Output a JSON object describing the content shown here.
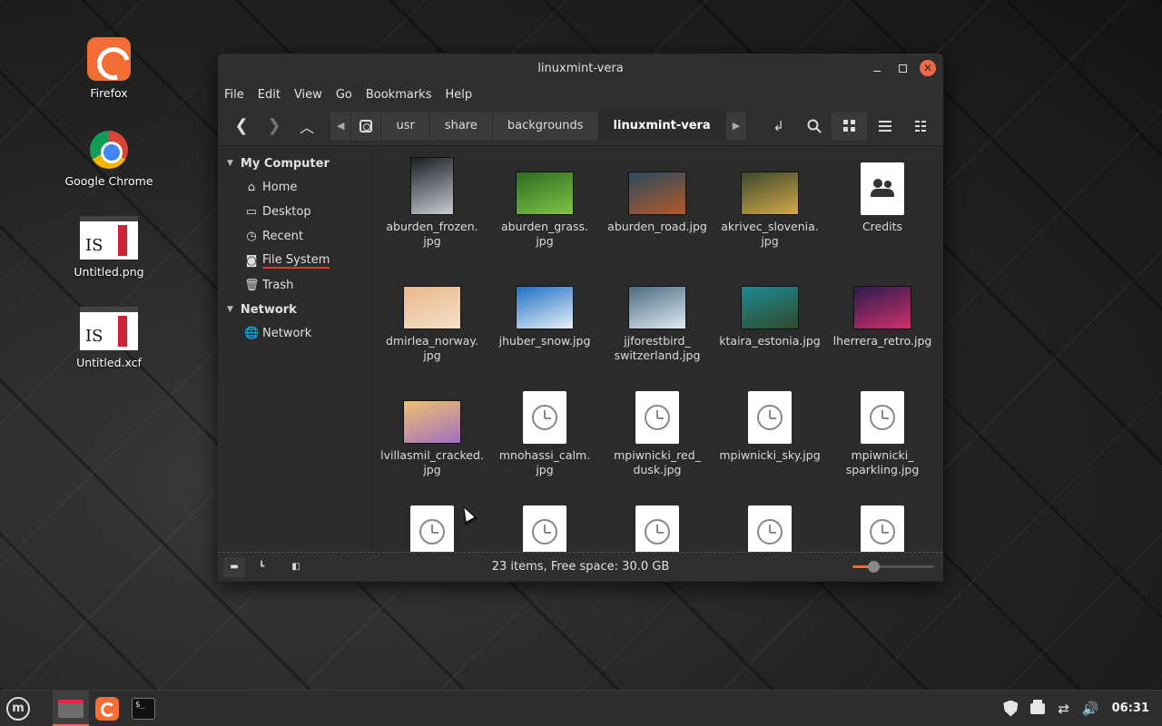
{
  "desktop": {
    "icons": [
      {
        "label": "Firefox",
        "icon": "firefox-icon"
      },
      {
        "label": "Google Chrome",
        "icon": "chrome-icon"
      },
      {
        "label": "Untitled.png",
        "icon": "image-file-icon"
      },
      {
        "label": "Untitled.xcf",
        "icon": "image-file-icon"
      }
    ]
  },
  "window": {
    "title": "linuxmint-vera",
    "menu": [
      "File",
      "Edit",
      "View",
      "Go",
      "Bookmarks",
      "Help"
    ],
    "breadcrumbs": [
      "usr",
      "share",
      "backgrounds",
      "linuxmint-vera"
    ],
    "sidebar": {
      "sections": [
        {
          "title": "My Computer",
          "items": [
            {
              "label": "Home",
              "icon": "home-icon"
            },
            {
              "label": "Desktop",
              "icon": "desktop-icon"
            },
            {
              "label": "Recent",
              "icon": "recent-icon"
            },
            {
              "label": "File System",
              "icon": "drive-icon"
            },
            {
              "label": "Trash",
              "icon": "trash-icon"
            }
          ]
        },
        {
          "title": "Network",
          "items": [
            {
              "label": "Network",
              "icon": "network-icon"
            }
          ]
        }
      ]
    },
    "files": [
      {
        "name": "aburden_frozen.\njpg",
        "type": "photo",
        "colors": [
          "#1a1d22",
          "#c8ccd2"
        ]
      },
      {
        "name": "aburden_grass.\njpg",
        "type": "photo",
        "colors": [
          "#2f6b22",
          "#7fc447"
        ]
      },
      {
        "name": "aburden_road.jpg",
        "type": "photo",
        "colors": [
          "#2b4a5c",
          "#b35a2a"
        ]
      },
      {
        "name": "akrivec_slovenia.\njpg",
        "type": "photo",
        "colors": [
          "#3b4a2a",
          "#d4a84a"
        ]
      },
      {
        "name": "Credits",
        "type": "document"
      },
      {
        "name": "dmirlea_norway.\njpg",
        "type": "photo",
        "colors": [
          "#e9b88a",
          "#f4e0c8"
        ]
      },
      {
        "name": "jhuber_snow.jpg",
        "type": "photo",
        "colors": [
          "#1d6fc4",
          "#e8f0f8"
        ]
      },
      {
        "name": "jjforestbird_\nswitzerland.jpg",
        "type": "photo",
        "colors": [
          "#4a6a80",
          "#e0ecf2"
        ]
      },
      {
        "name": "ktaira_estonia.jpg",
        "type": "photo",
        "colors": [
          "#1e8a94",
          "#2e4a2a"
        ]
      },
      {
        "name": "lherrera_retro.jpg",
        "type": "photo",
        "colors": [
          "#2a1b4e",
          "#d0306a"
        ]
      },
      {
        "name": "lvillasmil_cracked.\njpg",
        "type": "photo",
        "colors": [
          "#f0c070",
          "#a070c0"
        ]
      },
      {
        "name": "mnohassi_calm.\njpg",
        "type": "pending"
      },
      {
        "name": "mpiwnicki_red_\ndusk.jpg",
        "type": "pending"
      },
      {
        "name": "mpiwnicki_sky.jpg",
        "type": "pending"
      },
      {
        "name": "mpiwnicki_\nsparkling.jpg",
        "type": "pending"
      },
      {
        "name": "",
        "type": "pending"
      },
      {
        "name": "",
        "type": "pending"
      },
      {
        "name": "",
        "type": "pending"
      },
      {
        "name": "",
        "type": "pending"
      },
      {
        "name": "",
        "type": "pending"
      }
    ],
    "status": "23 items, Free space: 30.0 GB",
    "zoom_level": 0.5
  },
  "taskbar": {
    "clock": "06:31"
  },
  "colors": {
    "accent": "#f06a47",
    "window_bg": "#2b2b2b"
  }
}
